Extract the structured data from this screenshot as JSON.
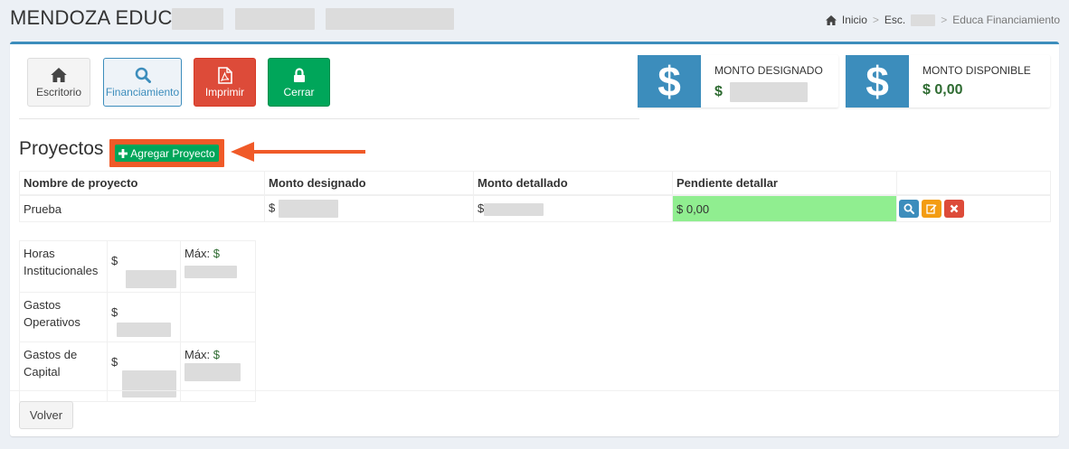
{
  "header": {
    "title": "MENDOZA EDUCA",
    "breadcrumb": [
      "Inicio",
      "Esc.",
      "Educa Financiamiento"
    ]
  },
  "toolbar": [
    {
      "label": "Escritorio",
      "icon": "home-icon"
    },
    {
      "label": "Financiamiento",
      "icon": "search-icon"
    },
    {
      "label": "Imprimir",
      "icon": "pdf-file-icon"
    },
    {
      "label": "Cerrar",
      "icon": "lock-icon"
    }
  ],
  "info": {
    "designado": {
      "label": "MONTO DESIGNADO",
      "value": "$"
    },
    "disponible": {
      "label": "MONTO DISPONIBLE",
      "value": "$ 0,00"
    },
    "icon": "dollar-icon",
    "color": "#3c8dbc"
  },
  "proyectos": {
    "title": "Proyectos",
    "add_label": "Agregar Proyecto",
    "columns": [
      "Nombre de proyecto",
      "Monto designado",
      "Monto detallado",
      "Pendiente detallar"
    ],
    "rows": [
      {
        "nombre": "Prueba",
        "designado": "$",
        "detallado": "$",
        "pendiente": "$ 0,00"
      }
    ]
  },
  "budget": [
    {
      "label": "Horas Institucionales",
      "amount": "$",
      "max_label": "Máx:",
      "max_value": "$"
    },
    {
      "label": "Gastos Operativos",
      "amount": "$",
      "max_label": "",
      "max_value": ""
    },
    {
      "label": "Gastos de Capital",
      "amount": "$",
      "max_label": "Máx:",
      "max_value": "$"
    }
  ],
  "footer": {
    "back_label": "Volver"
  },
  "colors": {
    "accent": "#3c8dbc",
    "success": "#00a65a",
    "danger": "#dd4b39",
    "warning": "#f39c12",
    "highlight": "#f05a28",
    "pending": "#90ee90"
  }
}
